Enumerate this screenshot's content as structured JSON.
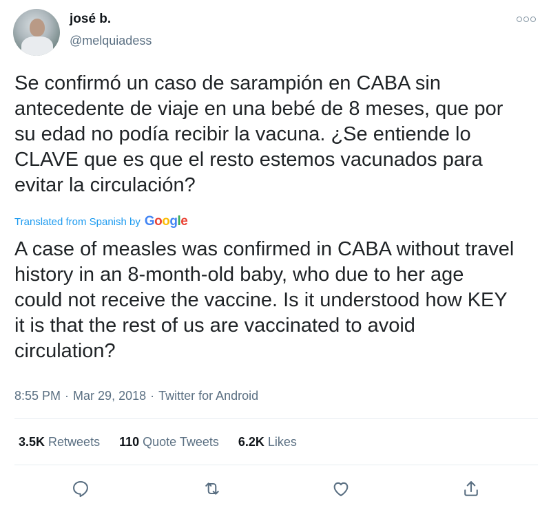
{
  "user": {
    "name": "josé b.",
    "handle": "@melquiadess"
  },
  "tweet": {
    "original_text": "Se confirmó un caso de sarampión en CABA sin\nantecedente de viaje en una bebé de 8 meses, que por\nsu edad no podía recibir la vacuna. ¿Se entiende lo\nCLAVE que es que el resto estemos vacunados para\nevitar la circulación?",
    "translation_label": "Translated from Spanish by",
    "translation_provider": "Google",
    "translated_text": "A case of measles was confirmed in CABA without travel\nhistory in an 8-month-old baby, who due to her age\ncould not receive the vaccine. Is it understood how KEY\nit is that the rest of us are vaccinated to avoid\ncirculation?",
    "time": "8:55 PM",
    "date": "Mar 29, 2018",
    "source": "Twitter for Android",
    "separator": "·"
  },
  "stats": {
    "retweets_count": "3.5K",
    "retweets_label": "Retweets",
    "quotes_count": "110",
    "quotes_label": "Quote Tweets",
    "likes_count": "6.2K",
    "likes_label": "Likes"
  },
  "colors": {
    "link": "#1d9bf0",
    "secondary_text": "#5b7083",
    "google_blue": "#4285F4",
    "google_red": "#EA4335",
    "google_yellow": "#FBBC05",
    "google_green": "#34A853"
  },
  "icons": {
    "more": "more-options-icon",
    "reply": "reply-icon",
    "retweet": "retweet-icon",
    "like": "like-icon",
    "share": "share-icon"
  }
}
